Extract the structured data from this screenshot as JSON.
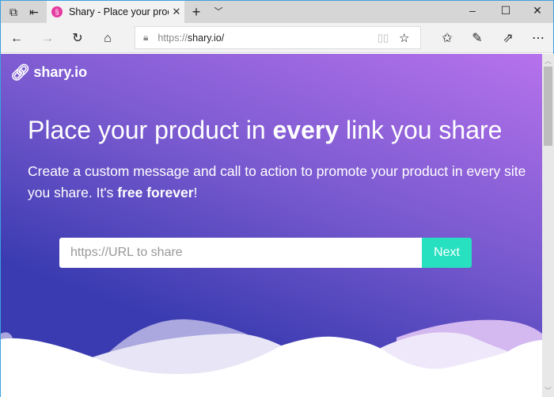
{
  "browser": {
    "tab_title": "Shary - Place your prod",
    "url_prefix": "https://",
    "url_host": "shary.io/",
    "icons": [
      "tab-preview-icon",
      "set-aside-tabs-icon",
      "close-icon",
      "new-tab-icon",
      "tab-list-chevron-icon",
      "minimize-icon",
      "maximize-icon",
      "window-close-icon",
      "back-icon",
      "forward-icon",
      "refresh-icon",
      "home-icon",
      "lock-icon",
      "reading-view-icon",
      "favorite-star-icon",
      "favorites-list-icon",
      "pen-icon",
      "share-icon",
      "more-icon"
    ]
  },
  "page": {
    "logo_text": "shary.io",
    "headline_pre": "Place your product in ",
    "headline_bold": "every",
    "headline_post": " link you share",
    "sub_pre": "Create a custom message and call to action to promote your product in every site you share. It's ",
    "sub_bold": "free forever",
    "sub_post": "!",
    "input_placeholder": "https://URL to share",
    "next_label": "Next"
  },
  "colors": {
    "accent": "#27e0c0",
    "gradient_start": "#3a3bb0",
    "gradient_end": "#b672ec"
  }
}
